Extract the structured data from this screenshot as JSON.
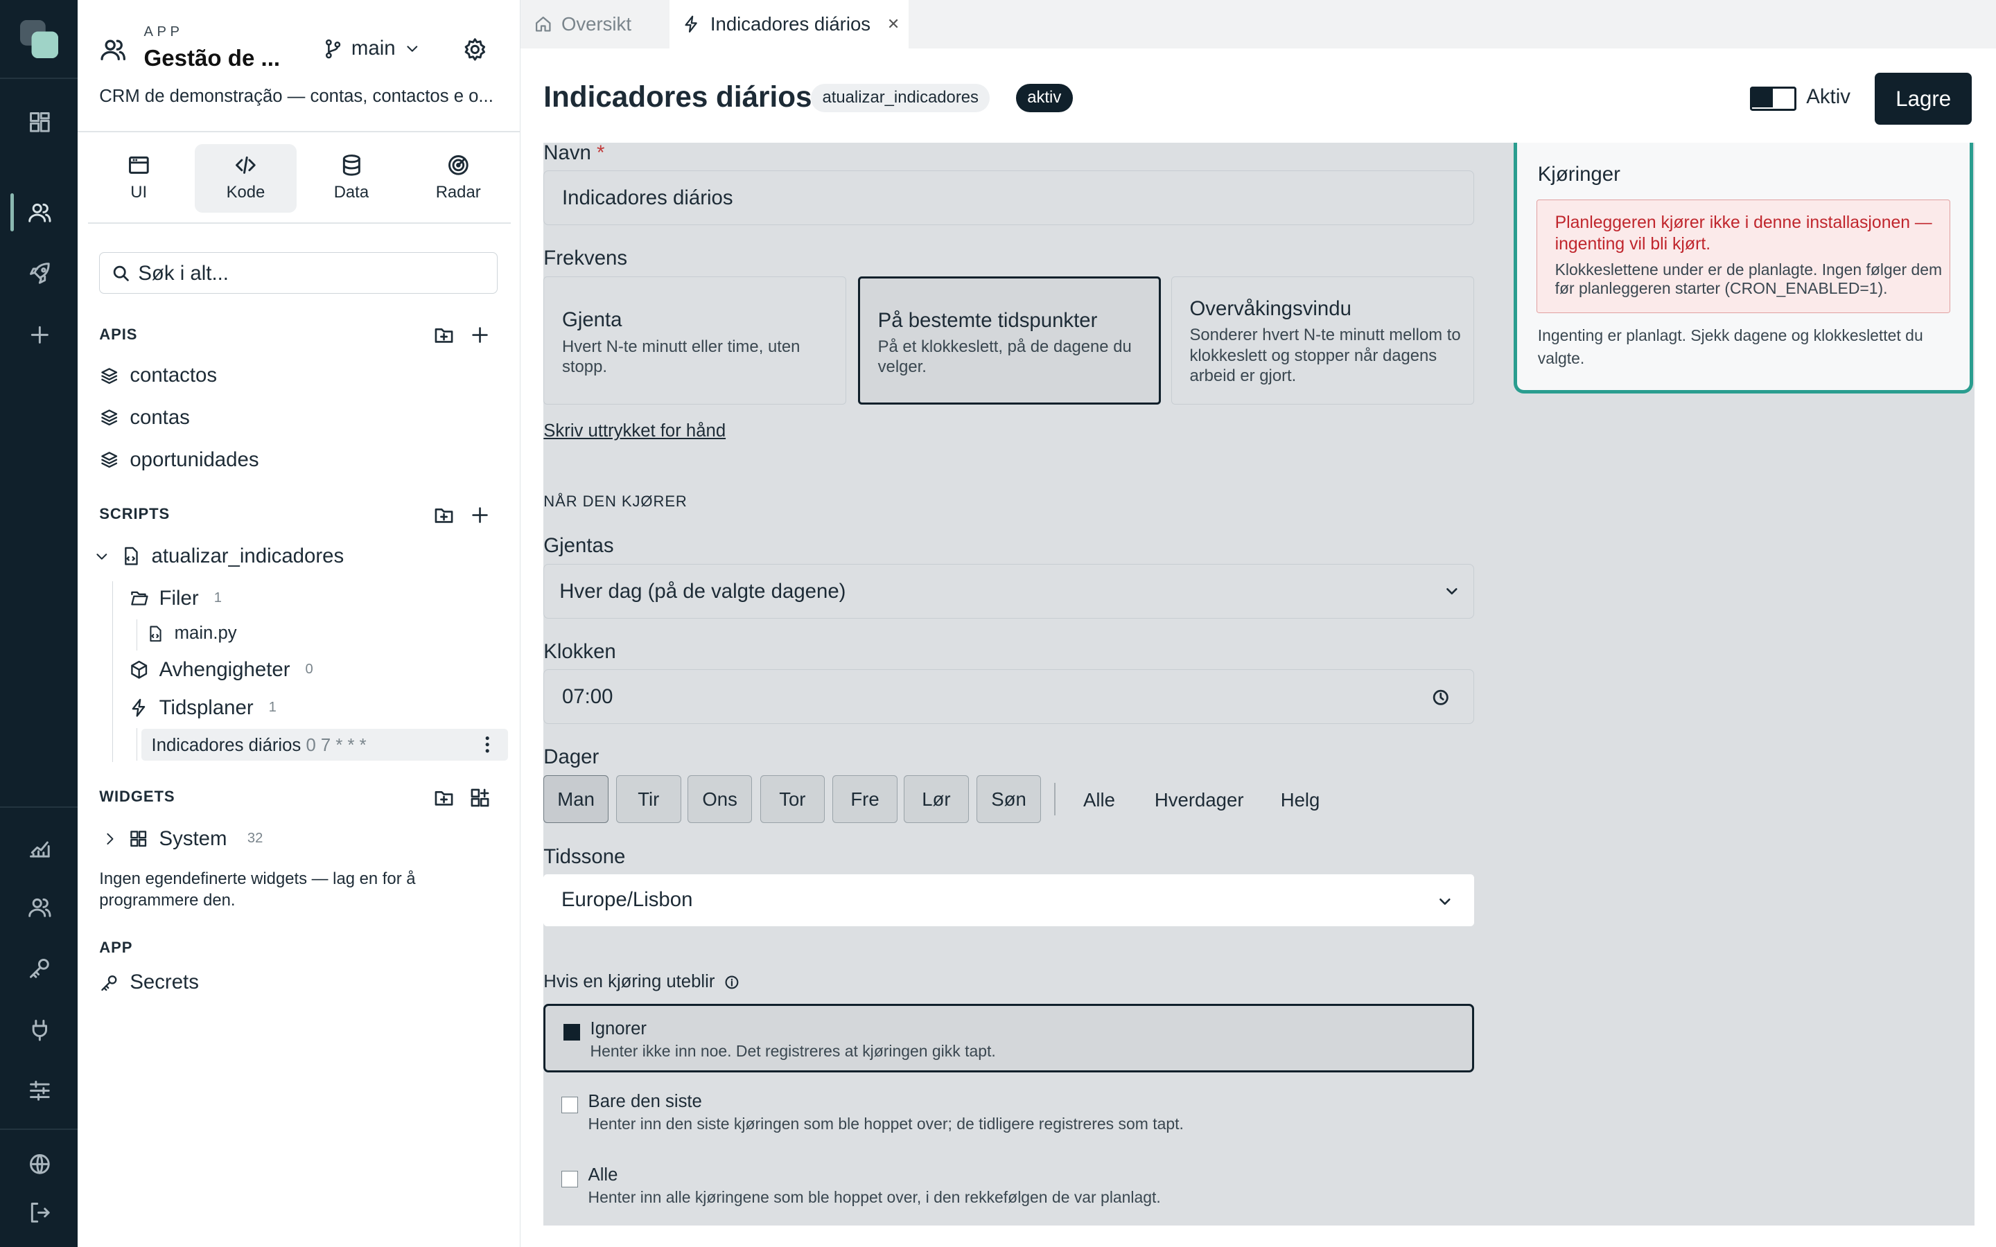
{
  "app": {
    "label": "APP",
    "title": "Gestão de ...",
    "branch": "main",
    "description": "CRM de demonstração — contas, contactos e o..."
  },
  "side_tabs": [
    {
      "label": "UI"
    },
    {
      "label": "Kode"
    },
    {
      "label": "Data"
    },
    {
      "label": "Radar"
    }
  ],
  "search": {
    "placeholder": "Søk i alt..."
  },
  "apis": {
    "heading": "APIS",
    "items": [
      "contactos",
      "contas",
      "oportunidades"
    ]
  },
  "scripts": {
    "heading": "SCRIPTS",
    "script_name": "atualizar_indicadores",
    "files": {
      "label": "Filer",
      "count": "1",
      "items": [
        "main.py"
      ]
    },
    "deps": {
      "label": "Avhengigheter",
      "count": "0"
    },
    "schedules": {
      "label": "Tidsplaner",
      "count": "1",
      "item_name": "Indicadores diários",
      "item_cron": "0 7 * * *"
    }
  },
  "widgets": {
    "heading": "WIDGETS",
    "system": "System",
    "system_count": "32",
    "note": "Ingen egendefinerte widgets — lag en for å programmere den."
  },
  "appsec": {
    "heading": "APP",
    "secrets": "Secrets"
  },
  "tabs": {
    "overview": "Oversikt",
    "current": "Indicadores diários"
  },
  "header": {
    "title": "Indicadores diários",
    "script_chip": "atualizar_indicadores",
    "status_chip": "aktiv",
    "toggle_label": "Aktiv",
    "save": "Lagre"
  },
  "form": {
    "name_label": "Navn",
    "required_mark": "*",
    "name_value": "Indicadores diários",
    "freq_label": "Frekvens",
    "freq_options": [
      {
        "title": "Gjenta",
        "desc": "Hvert N-te minutt eller time, uten stopp."
      },
      {
        "title": "På bestemte tidspunkter",
        "desc": "På et klokkeslett, på de dagene du velger."
      },
      {
        "title": "Overvåkingsvindu",
        "desc": "Sonderer hvert N-te minutt mellom to klokkeslett og stopper når dagens arbeid er gjort."
      }
    ],
    "manual_link": "Skriv uttrykket for hånd",
    "when_heading": "NÅR DEN KJØRER",
    "repeat_label": "Gjentas",
    "repeat_value": "Hver dag (på de valgte dagene)",
    "time_label": "Klokken",
    "time_value": "07:00",
    "days_label": "Dager",
    "days": [
      "Man",
      "Tir",
      "Ons",
      "Tor",
      "Fre",
      "Lør",
      "Søn"
    ],
    "day_quick": [
      "Alle",
      "Hverdager",
      "Helg"
    ],
    "tz_label": "Tidssone",
    "tz_value": "Europe/Lisbon",
    "miss_label": "Hvis en kjøring uteblir",
    "miss_options": [
      {
        "title": "Ignorer",
        "desc": "Henter ikke inn noe. Det registreres at kjøringen gikk tapt."
      },
      {
        "title": "Bare den siste",
        "desc": "Henter inn den siste kjøringen som ble hoppet over; de tidligere registreres som tapt."
      },
      {
        "title": "Alle",
        "desc": "Henter inn alle kjøringene som ble hoppet over, i den rekkefølgen de var planlagt."
      }
    ]
  },
  "runs": {
    "title": "Kjøringer",
    "warn_title": "Planleggeren kjører ikke i denne installasjonen — ingenting vil bli kjørt.",
    "warn_body": "Klokkeslettene under er de planlagte. Ingen følger dem før planleggeren starter (CRON_ENABLED=1).",
    "note": "Ingenting er planlagt. Sjekk dagene og klokkeslettet du valgte."
  },
  "colors": {
    "rail": "#10202b",
    "accent": "#2a9d8f",
    "danger": "#c0262d",
    "overlay": "#dcdfe2"
  }
}
